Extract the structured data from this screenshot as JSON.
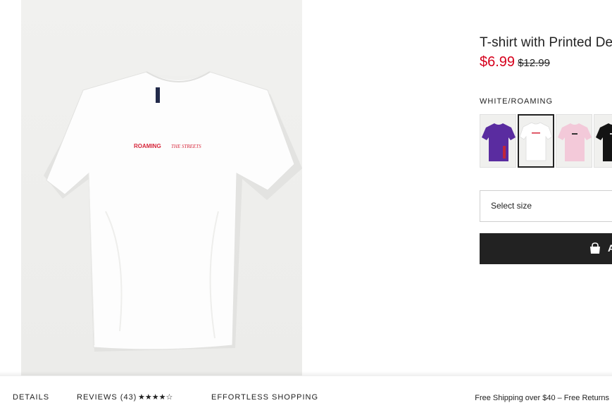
{
  "product": {
    "title": "T-shirt with Printed Design",
    "sale_price": "$6.99",
    "old_price": "$12.99",
    "print_text_bold": "ROAMING",
    "print_text_script": "THE STREETS",
    "color_name": "WHITE/ROAMING",
    "swatches": [
      {
        "color": "#5a2ca0",
        "label": "purple"
      },
      {
        "color": "#ffffff",
        "label": "white"
      },
      {
        "color": "#f3c9d9",
        "label": "pink"
      },
      {
        "color": "#141414",
        "label": "black"
      }
    ],
    "selected_swatch_index": 1
  },
  "size_select": {
    "label": "Select size"
  },
  "add_button": {
    "label": "A",
    "icon": "shopping-bag-icon"
  },
  "bottom_bar": {
    "details_tab": "DETAILS",
    "reviews_tab": "REVIEWS (43)",
    "reviews_stars": "★★★★☆",
    "rating": 4.5,
    "effortless_tab": "EFFORTLESS SHOPPING",
    "shipping_text": "Free Shipping over $40 – Free Returns"
  },
  "colors": {
    "sale": "#d6001c",
    "dark": "#222222"
  }
}
